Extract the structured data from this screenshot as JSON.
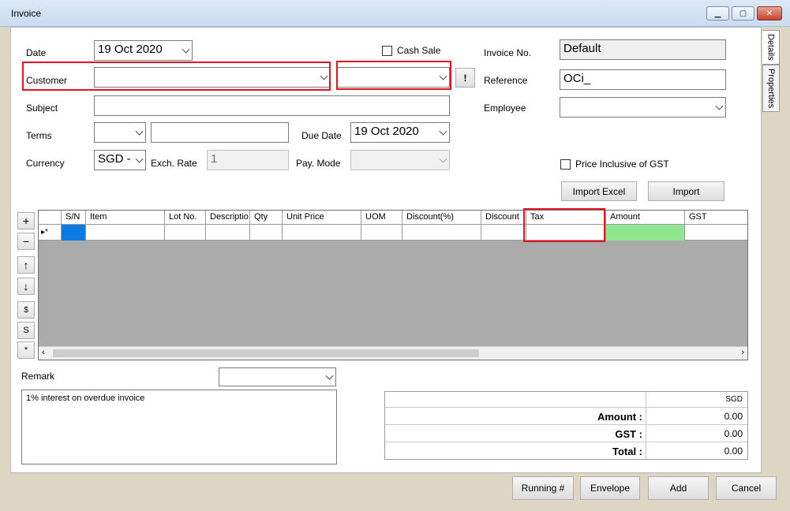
{
  "window": {
    "title": "Invoice"
  },
  "tabs": {
    "details": "Details",
    "properties": "Properties"
  },
  "form": {
    "date_label": "Date",
    "date_value": "19  Oct  2020",
    "cash_sale_label": "Cash Sale",
    "invoice_no_label": "Invoice No.",
    "invoice_no_value": "Default",
    "customer_label": "Customer",
    "customer_value": "",
    "customer_extra_value": "",
    "bang_button": "!",
    "reference_label": "Reference",
    "reference_value": "OCi_",
    "subject_label": "Subject",
    "subject_value": "",
    "employee_label": "Employee",
    "employee_value": "",
    "terms_label": "Terms",
    "terms_value": "",
    "terms_text": "",
    "due_date_label": "Due Date",
    "due_date_value": "19  Oct  2020",
    "currency_label": "Currency",
    "currency_value": "SGD -",
    "exch_rate_label": "Exch. Rate",
    "exch_rate_value": "1",
    "pay_mode_label": "Pay. Mode",
    "pay_mode_value": "",
    "price_inclusive_label": "Price Inclusive of GST",
    "import_excel_button": "Import Excel",
    "import_button": "Import"
  },
  "grid": {
    "columns": [
      "S/N",
      "Item",
      "Lot No.",
      "Descriptio",
      "Qty",
      "Unit Price",
      "UOM",
      "Discount(%)",
      "Discount",
      "Tax",
      "Amount",
      "GST"
    ],
    "row_marker": "▸*"
  },
  "side_buttons": [
    "+",
    "−",
    "↑",
    "↓",
    "$",
    "S",
    "*"
  ],
  "remark": {
    "label": "Remark",
    "dropdown_value": "",
    "text": "1% interest on overdue invoice"
  },
  "totals": {
    "currency": "SGD",
    "rows": [
      {
        "label": "Amount :",
        "value": "0.00"
      },
      {
        "label": "GST :",
        "value": "0.00"
      },
      {
        "label": "Total :",
        "value": "0.00"
      }
    ]
  },
  "footer": {
    "running_button": "Running #",
    "envelope_button": "Envelope",
    "add_button": "Add",
    "cancel_button": "Cancel"
  },
  "colors": {
    "highlight_red": "#e0141e",
    "sn_cell_blue": "#0a7be0",
    "amount_cell_green": "#8fe68f",
    "grid_background": "#ababab"
  }
}
